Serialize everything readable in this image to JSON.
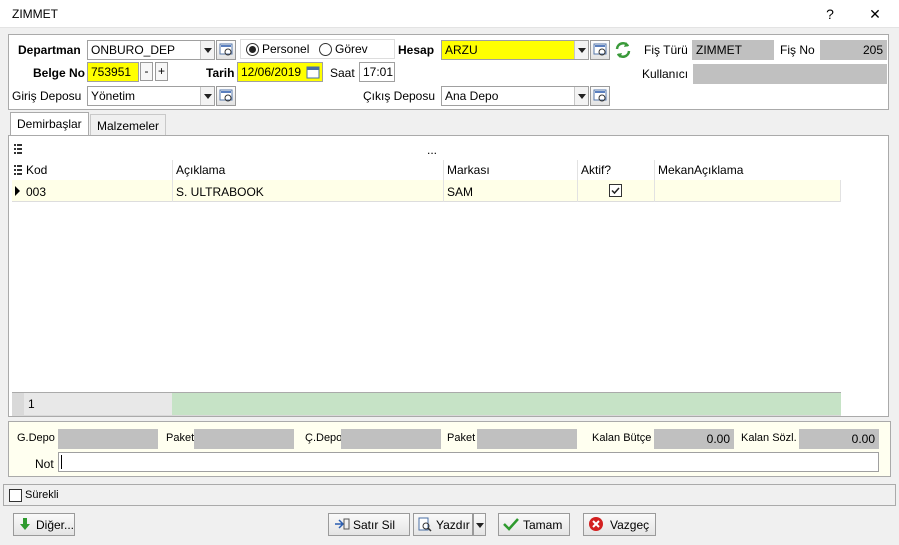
{
  "window": {
    "title": "ZIMMET",
    "help_label": "?",
    "close_label": "✕"
  },
  "header": {
    "departman_label": "Departman",
    "departman_value": "ONBURO_DEP",
    "radio_personel": "Personel",
    "radio_gorev": "Görev",
    "radio_selected": "personel",
    "hesap_label": "Hesap",
    "hesap_value": "ARZU",
    "fis_turu_label": "Fiş Türü",
    "fis_turu_value": "ZIMMET",
    "fis_no_label": "Fiş No",
    "fis_no_value": "205",
    "belge_no_label": "Belge No",
    "belge_no_value": "753951",
    "spin_minus": "-",
    "spin_plus": "+",
    "tarih_label": "Tarih",
    "tarih_value": "12/06/2019",
    "saat_label": "Saat",
    "saat_value": "17:01",
    "kullanici_label": "Kullanıcı",
    "kullanici_value": "",
    "giris_deposu_label": "Giriş Deposu",
    "giris_deposu_value": "Yönetim",
    "cikis_deposu_label": "Çıkış Deposu",
    "cikis_deposu_value": "Ana Depo"
  },
  "tabs": [
    {
      "label": "Demirbaşlar",
      "active": true
    },
    {
      "label": "Malzemeler",
      "active": false
    }
  ],
  "grid": {
    "toolbar_ellipsis": "...",
    "columns": [
      "Kod",
      "Açıklama",
      "Markası",
      "Aktif?",
      "MekanAçıklama"
    ],
    "rows": [
      {
        "kod": "003",
        "aciklama": "S. ULTRABOOK",
        "markasi": "SAM",
        "aktif": true,
        "mekan": ""
      }
    ],
    "footer_count": "1"
  },
  "bottom": {
    "gdepo_label": "G.Depo",
    "gdepo_value": "",
    "paket1_label": "Paket",
    "paket1_value": "",
    "cdepo_label": "Ç.Depo",
    "cdepo_value": "",
    "paket2_label": "Paket",
    "paket2_value": "",
    "kalan_butce_label": "Kalan Bütçe",
    "kalan_butce_value": "0.00",
    "kalan_sozl_label": "Kalan Sözl.",
    "kalan_sozl_value": "0.00",
    "not_label": "Not",
    "not_value": ""
  },
  "surekli_label": "Sürekli",
  "buttons": {
    "diger": "Diğer...",
    "satir_sil": "Satır Sil",
    "yazdir": "Yazdır",
    "tamam": "Tamam",
    "vazgec": "Vazgeç"
  },
  "colors": {
    "highlight_yellow": "#ffff00",
    "readonly_gray": "#c0c0c0",
    "grid_row": "#ffffe8",
    "grid_footer": "#c6e3c6"
  }
}
